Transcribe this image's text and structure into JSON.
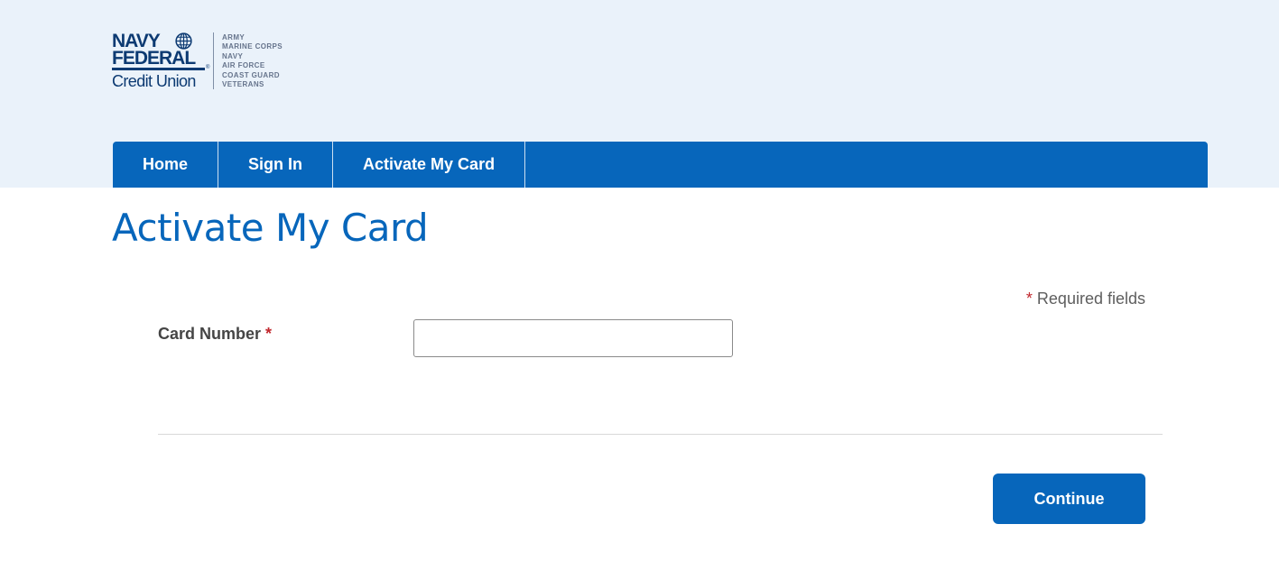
{
  "logo": {
    "line1": "NAVY",
    "line2": "FEDERAL",
    "line3": "Credit Union",
    "registered": "®",
    "icon": "globe-icon",
    "branches": [
      "ARMY",
      "MARINE CORPS",
      "NAVY",
      "AIR FORCE",
      "COAST GUARD",
      "VETERANS"
    ]
  },
  "nav": {
    "items": [
      {
        "label": "Home"
      },
      {
        "label": "Sign In"
      },
      {
        "label": "Activate My Card"
      }
    ]
  },
  "page": {
    "title": "Activate My Card"
  },
  "form": {
    "required_marker": "*",
    "required_note": "Required fields",
    "card_number_label": "Card Number",
    "card_number_value": "",
    "card_number_placeholder": "",
    "continue_label": "Continue"
  },
  "colors": {
    "brand_blue": "#0766bb",
    "header_background": "#eaf2fa",
    "logo_navy": "#0c3a72",
    "required_red": "#c1272d"
  }
}
